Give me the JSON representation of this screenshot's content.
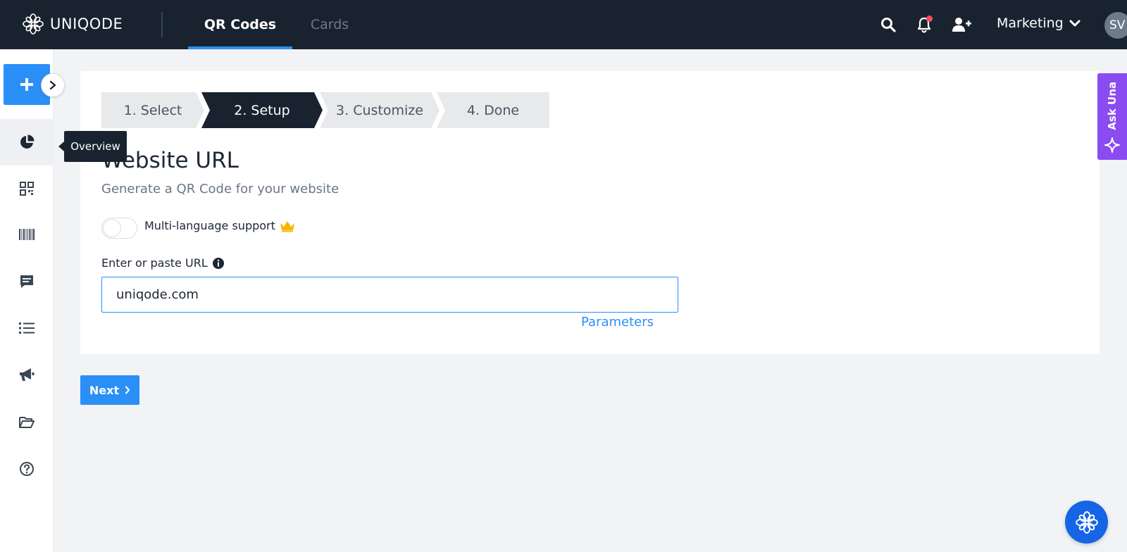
{
  "header": {
    "logo_text": "UNIQODE",
    "tabs": [
      {
        "label": "QR Codes",
        "active": true
      },
      {
        "label": "Cards",
        "active": false
      }
    ],
    "workspace": "Marketing",
    "avatar_initials": "SV"
  },
  "sidebar": {
    "tooltip": "Overview",
    "items": [
      {
        "icon": "pie-chart-icon",
        "active": true
      },
      {
        "icon": "qr-code-icon"
      },
      {
        "icon": "barcode-icon"
      },
      {
        "icon": "message-icon"
      },
      {
        "icon": "list-icon"
      },
      {
        "icon": "megaphone-icon"
      },
      {
        "icon": "folder-icon"
      },
      {
        "icon": "help-icon"
      }
    ]
  },
  "steps": [
    {
      "label": "1. Select",
      "active": false
    },
    {
      "label": "2. Setup",
      "active": true
    },
    {
      "label": "3. Customize",
      "active": false
    },
    {
      "label": "4. Done",
      "active": false
    }
  ],
  "form": {
    "title": "Website URL",
    "subtitle": "Generate a QR Code for your website",
    "multilang_label": "Multi-language support",
    "multilang_enabled": false,
    "url_label": "Enter or paste URL",
    "url_value": "uniqode.com",
    "parameters_link": "Parameters"
  },
  "actions": {
    "next_label": "Next"
  },
  "ask_una": {
    "label": "Ask Una"
  },
  "colors": {
    "topbar": "#192330",
    "primary": "#2a8ff7",
    "ask_una": "#8a4bf0",
    "crown": "#f5b800"
  }
}
